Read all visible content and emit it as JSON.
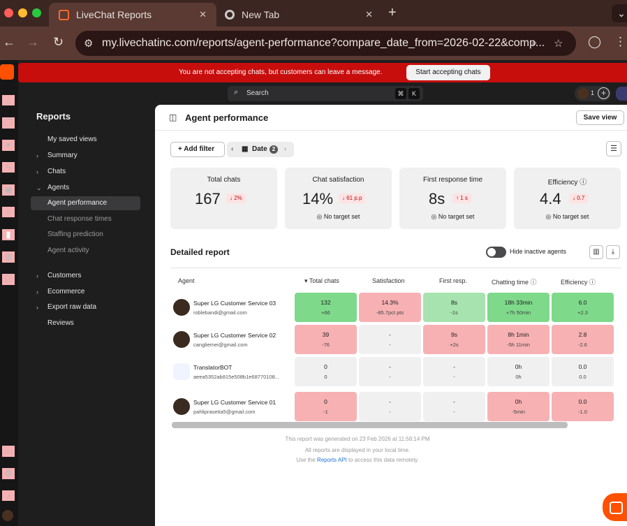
{
  "browser": {
    "tabs": [
      {
        "title": "LiveChat Reports",
        "active": true,
        "icon": "livechat-icon"
      },
      {
        "title": "New Tab",
        "active": false,
        "icon": "chrome-icon"
      }
    ],
    "new_tab_symbol": "+",
    "url": "my.livechatinc.com/reports/agent-performance?compare_date_from=2026-02-22&comp..."
  },
  "banner": {
    "message": "You are not accepting chats, but customers can leave a message.",
    "button": "Start accepting chats"
  },
  "search": {
    "label": "Search",
    "shortcut_1": "⌘",
    "shortcut_2": "K",
    "status_count": "1"
  },
  "sidebar": {
    "heading": "Reports",
    "items": [
      {
        "label": "My saved views",
        "level": 0
      },
      {
        "label": "Summary",
        "level": 0,
        "chevron": "›"
      },
      {
        "label": "Chats",
        "level": 0,
        "chevron": "›"
      },
      {
        "label": "Agents",
        "level": 0,
        "chevron": "⌄"
      },
      {
        "label": "Agent performance",
        "level": 1,
        "selected": true
      },
      {
        "label": "Chat response times",
        "level": 1
      },
      {
        "label": "Staffing prediction",
        "level": 1
      },
      {
        "label": "Agent activity",
        "level": 1
      },
      {
        "label": "Customers",
        "level": 0,
        "chevron": "›"
      },
      {
        "label": "Ecommerce",
        "level": 0,
        "chevron": "›"
      },
      {
        "label": "Export raw data",
        "level": 0,
        "chevron": "›"
      },
      {
        "label": "Reviews",
        "level": 0
      }
    ]
  },
  "page": {
    "title": "Agent performance",
    "save_view": "Save view",
    "add_filter": "Add filter",
    "date_filter": "Date",
    "date_filter_count": "2"
  },
  "kpis": [
    {
      "title": "Total chats",
      "value": "167",
      "delta": "2%",
      "direction": "down",
      "target": ""
    },
    {
      "title": "Chat satisfaction",
      "value": "14%",
      "delta": "61 p.p",
      "direction": "down",
      "target": "No target set"
    },
    {
      "title": "First response time",
      "value": "8s",
      "delta": "1 s",
      "direction": "up",
      "target": "No target set"
    },
    {
      "title": "Efficiency",
      "value": "4.4",
      "delta": "0.7",
      "direction": "down",
      "target": "No target set"
    }
  ],
  "report": {
    "title": "Detailed report",
    "hide_inactive": "Hide inactive agents",
    "columns": [
      "Agent",
      "Total chats",
      "Satisfaction",
      "First resp.",
      "Chatting time",
      "Efficiency"
    ],
    "rows": [
      {
        "name": "Super LG Customer Service 03",
        "email": "roblebandi@gmail.com",
        "avatar": "bot-avatar-eagle",
        "cells": [
          [
            "132",
            "+66",
            "g"
          ],
          [
            "14.3%",
            "-85.7pct pts",
            "r"
          ],
          [
            "8s",
            "-1s",
            "lg"
          ],
          [
            "18h 33min",
            "+7h 50min",
            "g"
          ],
          [
            "6.0",
            "+2.3",
            "g"
          ]
        ]
      },
      {
        "name": "Super LG Customer Service 02",
        "email": "cangliemei@gmail.com",
        "avatar": "bot-avatar-eagle",
        "cells": [
          [
            "39",
            "-76",
            "r"
          ],
          [
            "-",
            "-",
            "n"
          ],
          [
            "9s",
            "+2s",
            "r"
          ],
          [
            "8h 1min",
            "-5h 11min",
            "r"
          ],
          [
            "2.8",
            "-2.6",
            "r"
          ]
        ]
      },
      {
        "name": "TranslatorBOT",
        "email": "aeea5352ab815e508b1e68770108...",
        "avatar": "robot-avatar",
        "cells": [
          [
            "0",
            "0",
            "n"
          ],
          [
            "-",
            "-",
            "n"
          ],
          [
            "-",
            "-",
            "n"
          ],
          [
            "0h",
            "0h",
            "n"
          ],
          [
            "0.0",
            "0.0",
            "n"
          ]
        ]
      },
      {
        "name": "Super LG Customer Service 01",
        "email": "pahliprasetia5@gmail.com",
        "avatar": "bot-avatar-eagle",
        "cells": [
          [
            "0",
            "-1",
            "r"
          ],
          [
            "-",
            "-",
            "n"
          ],
          [
            "-",
            "-",
            "n"
          ],
          [
            "0h",
            "-5min",
            "r"
          ],
          [
            "0.0",
            "-1.0",
            "r"
          ]
        ]
      }
    ],
    "footer_line1": "This report was generated on 23 Feb 2026 at 11:58:14 PM",
    "footer_line2": "All reports are displayed in your local time.",
    "footer_line3_pre": "Use the ",
    "footer_link": "Reports API",
    "footer_line3_post": " to access this data remotely."
  },
  "colors": {
    "banner": "#c80d0d",
    "brand": "#ff5100",
    "good": "#7ed98a",
    "bad": "#f7b1b3"
  }
}
